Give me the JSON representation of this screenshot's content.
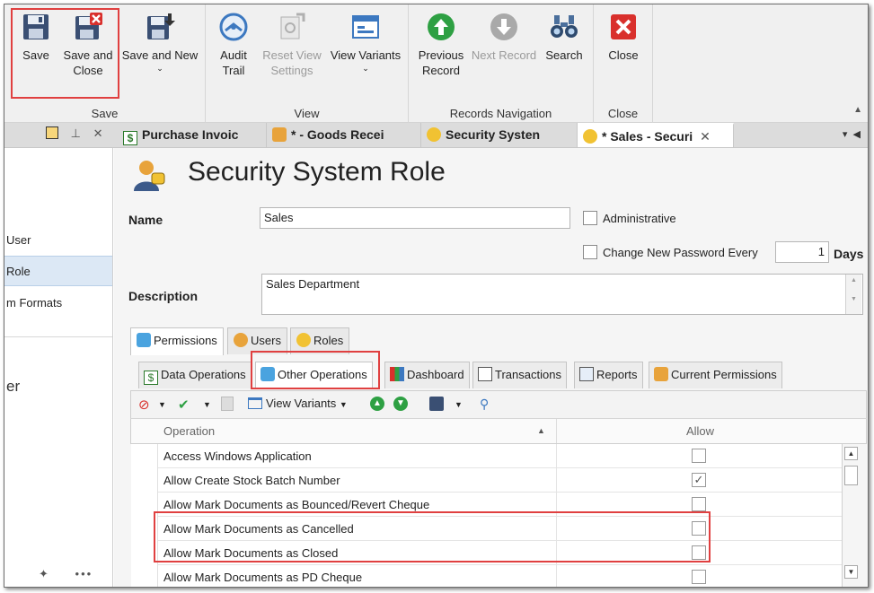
{
  "ribbon": {
    "groups": {
      "save": "Save",
      "view": "View",
      "records_navigation": "Records Navigation",
      "close": "Close"
    },
    "buttons": {
      "save": "Save",
      "save_and_close_1": "Save and",
      "save_and_close_2": "Close",
      "save_and_new": "Save and New",
      "audit_trail_1": "Audit",
      "audit_trail_2": "Trail",
      "reset_view_1": "Reset View",
      "reset_view_2": "Settings",
      "view_variants": "View Variants",
      "previous_record_1": "Previous",
      "previous_record_2": "Record",
      "next_record": "Next Record",
      "search": "Search",
      "close": "Close"
    },
    "colors": {
      "highlight": "#e04040",
      "green": "#2ea043",
      "red": "#d9302c",
      "blue": "#3c78c0"
    }
  },
  "doc_tabs": [
    {
      "label": "Purchase Invoic",
      "icon": "dollar-doc-icon"
    },
    {
      "label": "* - Goods Recei",
      "icon": "goods-icon"
    },
    {
      "label": "Security Systen",
      "icon": "mask-icon"
    },
    {
      "label": "* Sales - Securi",
      "icon": "mask-icon",
      "active": true
    }
  ],
  "sidenav": {
    "items": [
      "User",
      "Role",
      "m Formats"
    ],
    "partial_text": "er"
  },
  "form": {
    "title": "Security System Role",
    "name_label": "Name",
    "name_value": "Sales",
    "administrative_label": "Administrative",
    "change_password_label": "Change New Password Every",
    "change_password_value": "1",
    "days_label": "Days",
    "description_label": "Description",
    "description_value": "Sales Department"
  },
  "tabs_level1": [
    "Permissions",
    "Users",
    "Roles"
  ],
  "tabs_level2": [
    "Data Operations",
    "Other Operations",
    "Dashboard",
    "Transactions",
    "Reports",
    "Current Permissions"
  ],
  "grid_toolbar": {
    "view_variants": "View Variants"
  },
  "grid": {
    "col_operation": "Operation",
    "col_allow": "Allow",
    "rows": [
      {
        "operation": "Access Windows Application",
        "allow": false
      },
      {
        "operation": "Allow Create Stock Batch Number",
        "allow": true
      },
      {
        "operation": "Allow Mark Documents as Bounced/Revert Cheque",
        "allow": false
      },
      {
        "operation": "Allow Mark Documents as Cancelled",
        "allow": false
      },
      {
        "operation": "Allow Mark Documents as Closed",
        "allow": false
      },
      {
        "operation": "Allow Mark Documents as PD Cheque",
        "allow": false
      }
    ]
  }
}
